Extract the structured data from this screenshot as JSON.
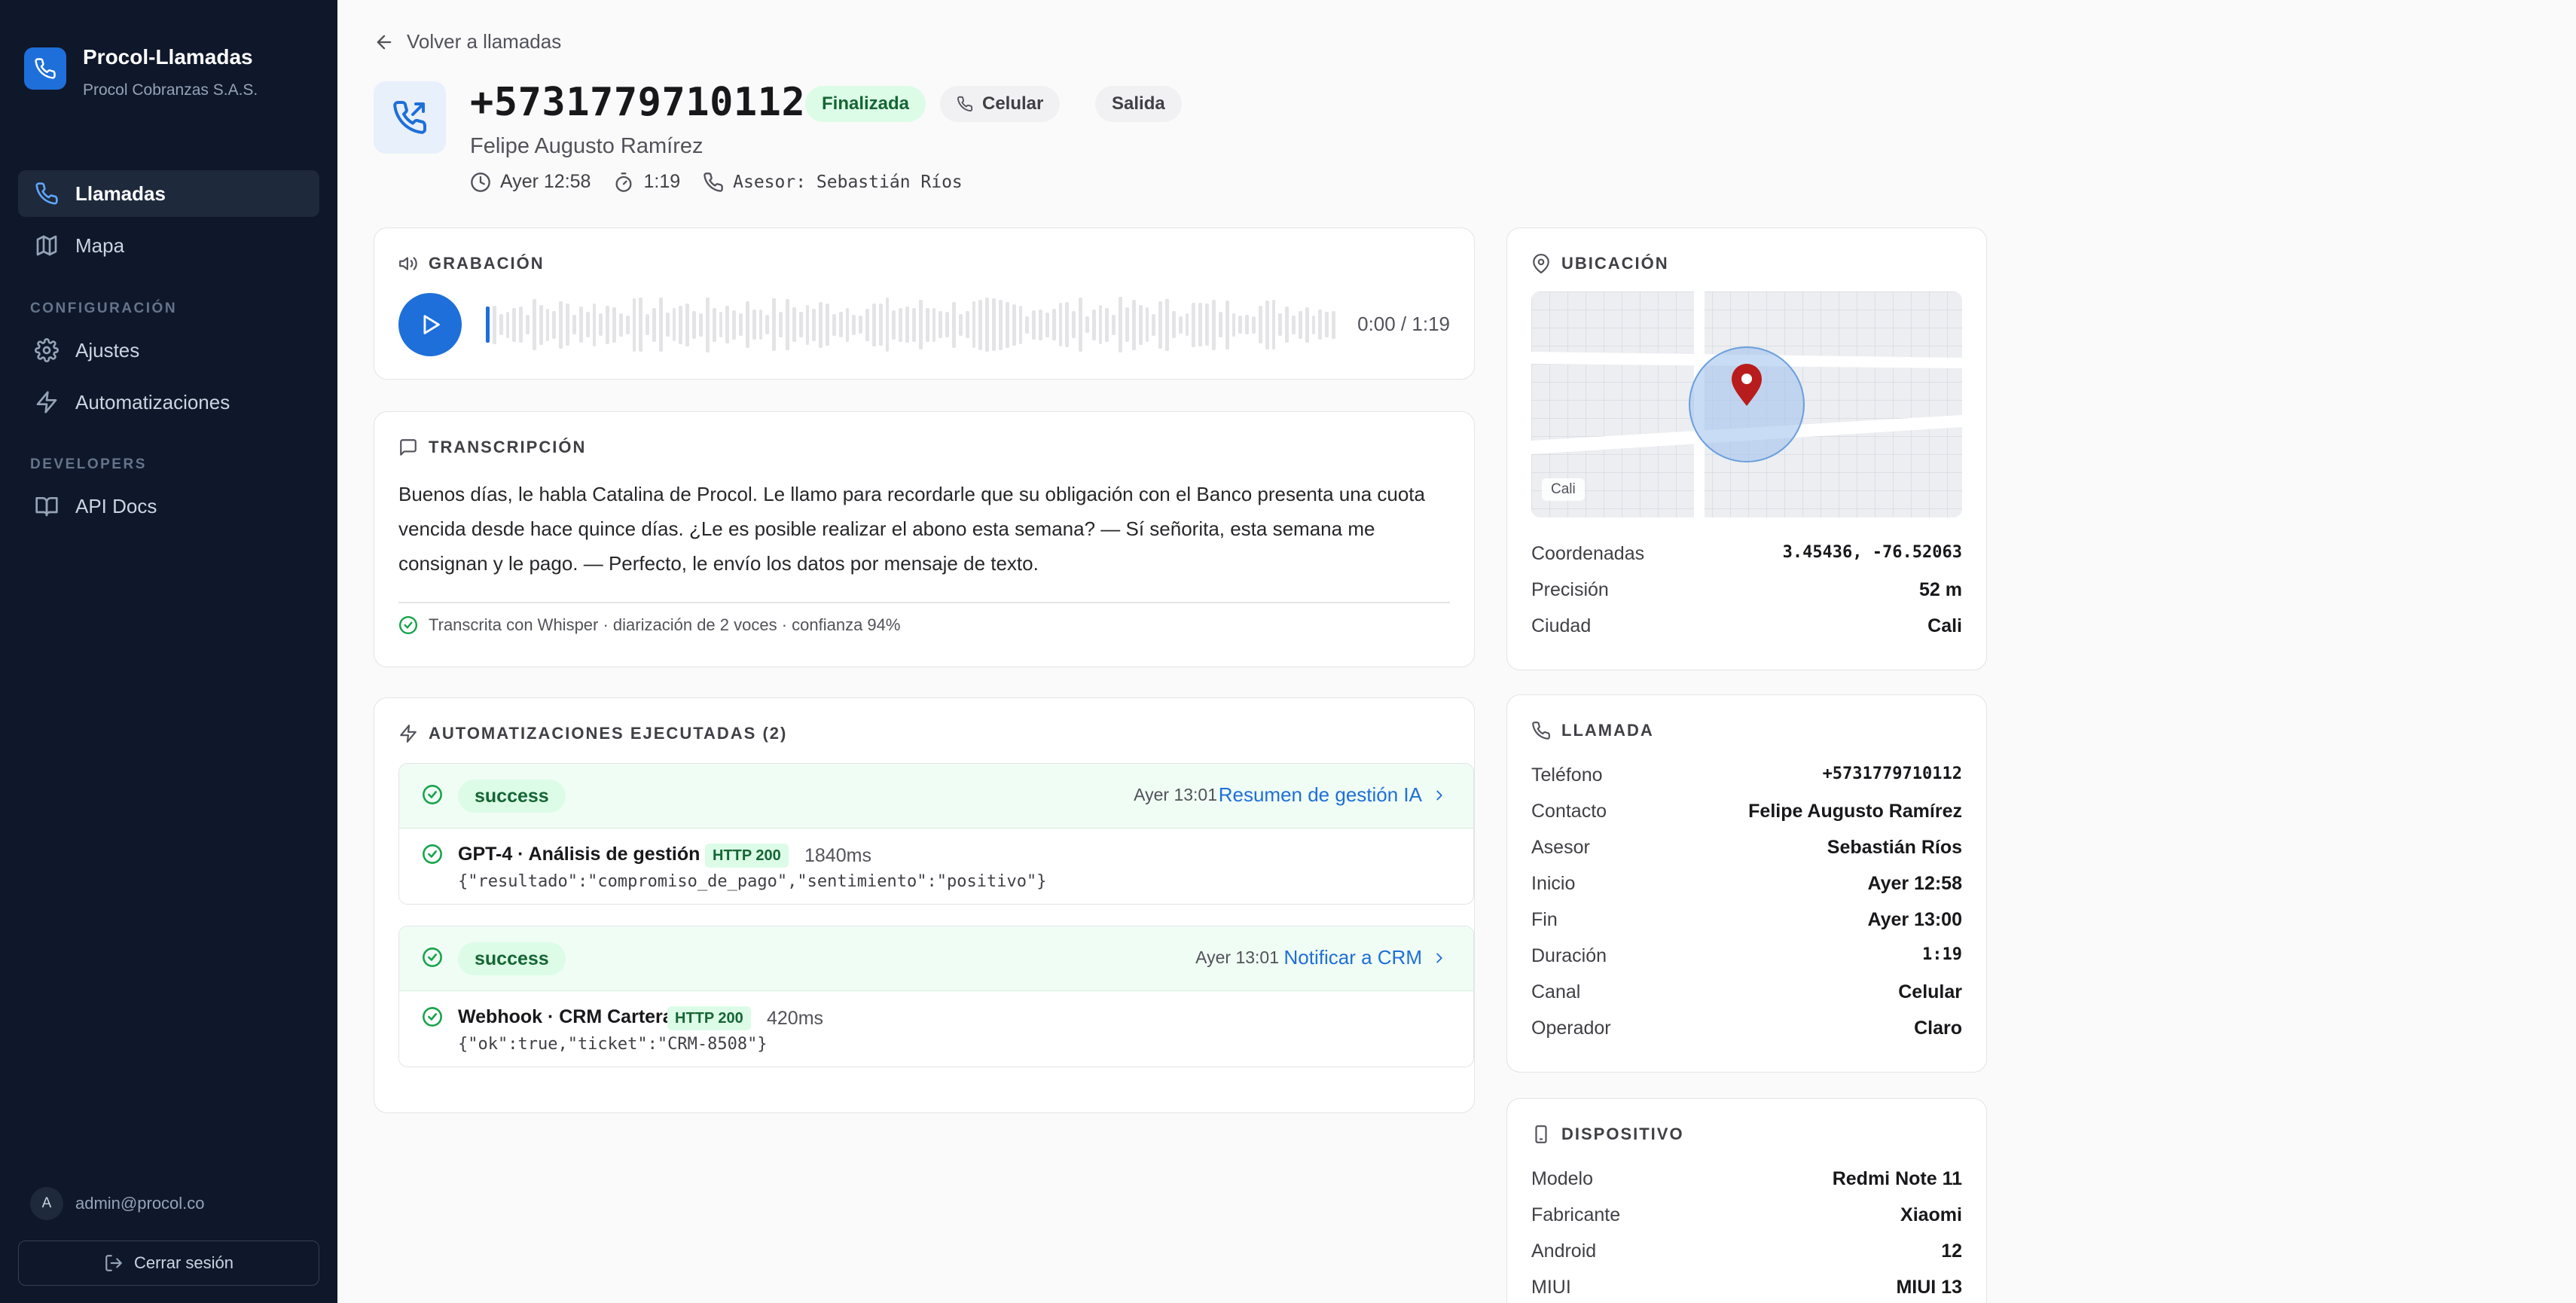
{
  "app": {
    "name": "Procol-Llamadas",
    "org": "Procol Cobranzas S.A.S."
  },
  "nav": {
    "items": [
      {
        "label": "Llamadas",
        "icon": "phone-icon",
        "active": true
      },
      {
        "label": "Mapa",
        "icon": "map-icon"
      }
    ],
    "config_section": "CONFIGURACIÓN",
    "config_items": [
      {
        "label": "Ajustes",
        "icon": "gear-icon"
      },
      {
        "label": "Automatizaciones",
        "icon": "bolt-icon"
      }
    ],
    "dev_section": "DEVELOPERS",
    "dev_items": [
      {
        "label": "API Docs",
        "icon": "book-icon"
      }
    ]
  },
  "user": {
    "initial": "A",
    "email": "admin@procol.co",
    "logout": "Cerrar sesión"
  },
  "back_label": "Volver a llamadas",
  "call": {
    "phone": "+5731779710112",
    "status": "Finalizada",
    "channel": "Celular",
    "direction": "Salida",
    "contact": "Felipe Augusto Ramírez",
    "when": "Ayer 12:58",
    "duration": "1:19",
    "agent": "Asesor: Sebastián Ríos"
  },
  "recording": {
    "title": "GRABACIÓN",
    "time": "0:00 / 1:19",
    "progress": 0
  },
  "transcript": {
    "title": "TRANSCRIPCIÓN",
    "text": "Buenos días, le habla Catalina de Procol. Le llamo para recordarle que su obligación con el Banco presenta una cuota vencida desde hace quince días. ¿Le es posible realizar el abono esta semana? — Sí señorita, esta semana me consignan y le pago. — Perfecto, le envío los datos por mensaje de texto.",
    "footer": "Transcrita con Whisper · diarización de 2 voces · confianza 94%"
  },
  "automations": {
    "title": "AUTOMATIZACIONES EJECUTADAS (2)",
    "runs": [
      {
        "status": "success",
        "time": "Ayer 13:01",
        "link": "Resumen de gestión IA",
        "step": "GPT-4 · Análisis de gestión",
        "http": "HTTP 200",
        "ms": "1840ms",
        "payload": "{\"resultado\":\"compromiso_de_pago\",\"sentimiento\":\"positivo\"}"
      },
      {
        "status": "success",
        "time": "Ayer 13:01",
        "link": "Notificar a CRM",
        "step": "Webhook · CRM Cartera",
        "http": "HTTP 200",
        "ms": "420ms",
        "payload": "{\"ok\":true,\"ticket\":\"CRM-8508\"}"
      }
    ]
  },
  "location": {
    "title": "UBICACIÓN",
    "map_label": "Cali",
    "rows": [
      {
        "k": "Coordenadas",
        "v": "3.45436, -76.52063"
      },
      {
        "k": "Precisión",
        "v": "52 m"
      },
      {
        "k": "Ciudad",
        "v": "Cali"
      }
    ]
  },
  "call_card": {
    "title": "LLAMADA",
    "rows": [
      {
        "k": "Teléfono",
        "v": "+5731779710112"
      },
      {
        "k": "Contacto",
        "v": "Felipe Augusto Ramírez"
      },
      {
        "k": "Asesor",
        "v": "Sebastián Ríos"
      },
      {
        "k": "Inicio",
        "v": "Ayer 12:58"
      },
      {
        "k": "Fin",
        "v": "Ayer 13:00"
      },
      {
        "k": "Duración",
        "v": "1:19"
      },
      {
        "k": "Canal",
        "v": "Celular"
      },
      {
        "k": "Operador",
        "v": "Claro"
      }
    ]
  },
  "device": {
    "title": "DISPOSITIVO",
    "rows": [
      {
        "k": "Modelo",
        "v": "Redmi Note 11"
      },
      {
        "k": "Fabricante",
        "v": "Xiaomi"
      },
      {
        "k": "Android",
        "v": "12"
      },
      {
        "k": "MIUI",
        "v": "MIUI 13"
      }
    ]
  },
  "colors": {
    "sidebar": "#0f172a",
    "accent": "#1e6fd9",
    "success": "#166534",
    "pin": "#b91c1c"
  }
}
